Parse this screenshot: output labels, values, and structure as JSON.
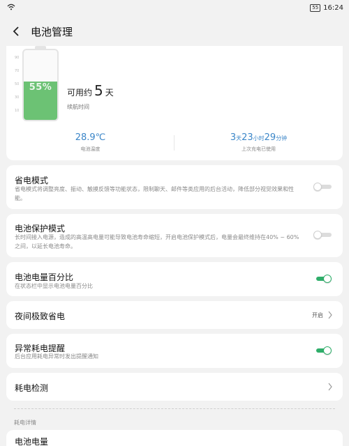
{
  "status_bar": {
    "wifi_icon": "wifi-icon",
    "battery_badge": "55",
    "time": "16:24"
  },
  "header": {
    "back_icon": "chevron-left-icon",
    "title": "电池管理"
  },
  "overview": {
    "scale": [
      "90",
      "70",
      "50",
      "30",
      "10"
    ],
    "battery_level": 0.55,
    "battery_percent": "55%",
    "available_prefix": "可用约",
    "available_value": "5",
    "available_unit": "天",
    "available_sub": "续航时间",
    "temperature": {
      "value": "28.9℃",
      "label": "电池温度"
    },
    "since_charge": {
      "d": "3",
      "d_unit": "天",
      "h": "23",
      "h_unit": "小时",
      "m": "29",
      "m_unit": "分钟",
      "label": "上次充电已使用"
    }
  },
  "settings": {
    "power_saving": {
      "title": "省电模式",
      "desc": "省电模式将调整亮度、振动、触摸反馈等功能状态，限制聊天、邮件等类应用的后台活动，降低部分视觉效果和性能。",
      "enabled": false
    },
    "battery_protect": {
      "title": "电池保护模式",
      "desc": "长时间接入电源，造成的高温高电量可能导致电池寿命缩短，开启电池保护模式后，电量会最终维持在40% ~ 60%之间，以延长电池寿命。",
      "enabled": false
    },
    "battery_percent": {
      "title": "电池电量百分比",
      "desc": "在状态栏中显示电池电量百分比",
      "enabled": true
    },
    "night_saving": {
      "title": "夜间极致省电",
      "value": "开启"
    },
    "abnormal_alert": {
      "title": "异常耗电提醒",
      "desc": "后台应用耗电异常时发出提醒通知",
      "enabled": true
    },
    "power_check": {
      "title": "耗电检测"
    }
  },
  "details": {
    "section_label": "耗电详情",
    "battery_level_title": "电池电量"
  },
  "colors": {
    "accent_green": "#6cc274",
    "toggle_on": "#2fae6a",
    "stat_blue": "#3b86c8"
  }
}
